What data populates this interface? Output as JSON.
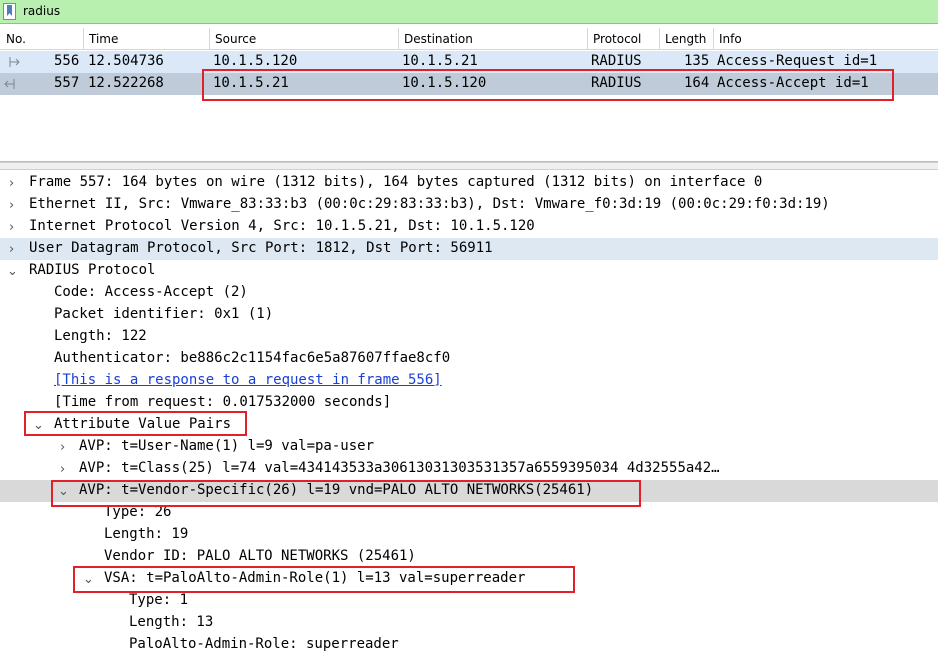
{
  "filter": {
    "value": "radius"
  },
  "packet_list": {
    "columns": [
      "No.",
      "Time",
      "Source",
      "Destination",
      "Protocol",
      "Length",
      "Info"
    ],
    "rows": [
      {
        "no": "556",
        "time": "12.504736",
        "source": "10.1.5.120",
        "destination": "10.1.5.21",
        "protocol": "RADIUS",
        "length": "135",
        "info": "Access-Request id=1"
      },
      {
        "no": "557",
        "time": "12.522268",
        "source": "10.1.5.21",
        "destination": "10.1.5.120",
        "protocol": "RADIUS",
        "length": "164",
        "info": "Access-Accept id=1"
      }
    ]
  },
  "details": {
    "frame": "Frame 557: 164 bytes on wire (1312 bits), 164 bytes captured (1312 bits) on interface 0",
    "ethernet": "Ethernet II, Src: Vmware_83:33:b3 (00:0c:29:83:33:b3), Dst: Vmware_f0:3d:19 (00:0c:29:f0:3d:19)",
    "ip": "Internet Protocol Version 4, Src: 10.1.5.21, Dst: 10.1.5.120",
    "udp": "User Datagram Protocol, Src Port: 1812, Dst Port: 56911",
    "radius": "RADIUS Protocol",
    "code": "Code: Access-Accept (2)",
    "packet_id": "Packet identifier: 0x1 (1)",
    "length": "Length: 122",
    "authenticator": "Authenticator: be886c2c1154fac6e5a87607ffae8cf0",
    "response_link": "[This is a response to a request in frame 556]",
    "time_from_request": "[Time from request: 0.017532000 seconds]",
    "avp_header": "Attribute Value Pairs",
    "avp_username": "AVP: t=User-Name(1) l=9 val=pa-user",
    "avp_class": "AVP: t=Class(25) l=74 val=434143533a30613031303531357a6559395034 4d32555a42…",
    "avp_vendor": "AVP: t=Vendor-Specific(26) l=19 vnd=PALO ALTO NETWORKS(25461)",
    "vendor_type": "Type: 26",
    "vendor_length": "Length: 19",
    "vendor_id": "Vendor ID: PALO ALTO NETWORKS (25461)",
    "vsa": "VSA: t=PaloAlto-Admin-Role(1) l=13 val=superreader",
    "vsa_type": "Type: 1",
    "vsa_length": "Length: 13",
    "vsa_role": "PaloAlto-Admin-Role: superreader"
  },
  "icons": {
    "bookmark": "bookmark-icon",
    "expand": "chevron-right-icon",
    "collapse": "chevron-down-icon"
  },
  "colors": {
    "filter_bg": "#b8f0b0",
    "row_request": "#dbe8f8",
    "row_selected": "#bfcbd9",
    "highlight_box": "#e0212a"
  }
}
